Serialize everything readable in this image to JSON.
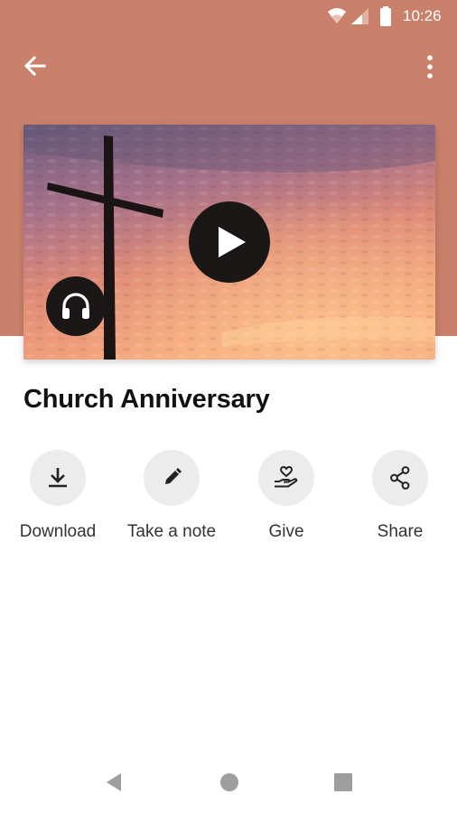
{
  "status_bar": {
    "time": "10:26"
  },
  "app_bar": {
    "back_icon": "arrow-left-icon",
    "menu_icon": "more-vert-icon"
  },
  "media": {
    "play_icon": "play-icon",
    "audio_icon": "headphones-icon",
    "artwork": "cross-sunset-image"
  },
  "sermon": {
    "title": "Church Anniversary"
  },
  "actions": [
    {
      "label": "Download",
      "icon": "download-icon"
    },
    {
      "label": "Take a note",
      "icon": "pencil-icon"
    },
    {
      "label": "Give",
      "icon": "give-heart-hand-icon"
    },
    {
      "label": "Share",
      "icon": "share-icon"
    }
  ],
  "nav_bar": {
    "back": "nav-back-icon",
    "home": "nav-home-icon",
    "recents": "nav-recents-icon"
  },
  "colors": {
    "header": "#c9816b",
    "button_dark": "#1b1716",
    "action_circle": "#ececec"
  }
}
